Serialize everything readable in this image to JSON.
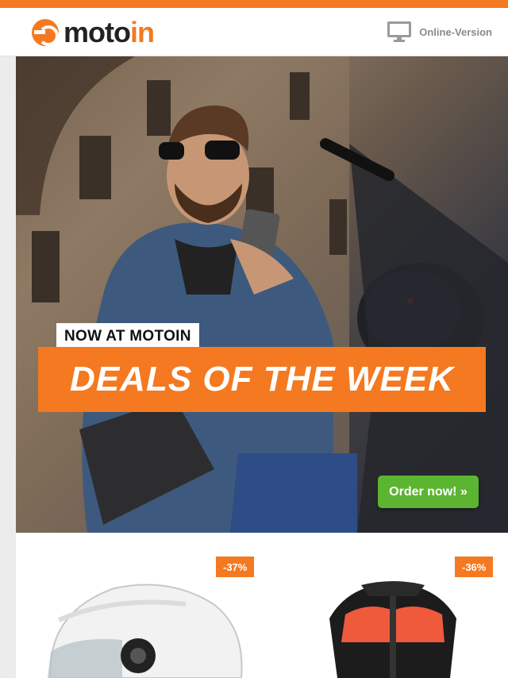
{
  "header": {
    "logo": {
      "part1": "moto",
      "part2": "in"
    },
    "online_version": "Online-Version"
  },
  "hero": {
    "tag": "NOW AT MOTOIN",
    "headline": "DEALS OF THE WEEK",
    "cta": "Order now! »"
  },
  "products": [
    {
      "discount": "-37%",
      "icon": "helmet-image"
    },
    {
      "discount": "-36%",
      "icon": "jacket-image"
    }
  ],
  "colors": {
    "brand": "#f47920",
    "cta": "#5cb531"
  }
}
